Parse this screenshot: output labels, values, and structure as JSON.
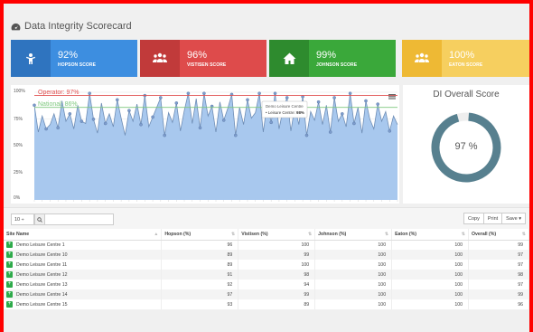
{
  "title": "Data Integrity Scorecard",
  "cards": [
    {
      "pct": "92%",
      "label": "HOPSON SCORE",
      "color": "#3d8ee0",
      "icon_bg": "#2f74bf",
      "icon": "person-icon"
    },
    {
      "pct": "96%",
      "label": "VISTISEN SCORE",
      "color": "#de4b4b",
      "icon_bg": "#c13a3a",
      "icon": "group-icon"
    },
    {
      "pct": "99%",
      "label": "JOHNSON SCORE",
      "color": "#3aa83a",
      "icon_bg": "#2e8b2e",
      "icon": "home-icon"
    },
    {
      "pct": "100%",
      "label": "EATON SCORE",
      "color": "#f6cf5f",
      "icon_bg": "#eeb934",
      "icon": "group-icon"
    }
  ],
  "chart": {
    "operator_label": "Operator: 97%",
    "national_label": "National: 86%",
    "operator_value": 97,
    "national_value": 86,
    "y_ticks": [
      "100%",
      "75%",
      "50%",
      "25%",
      "0%"
    ],
    "tooltip_title": "Demo Leisure Centre",
    "tooltip_line": "• Leisure Centre: ",
    "tooltip_value": "98%"
  },
  "chart_data": {
    "type": "area",
    "ylim": [
      0,
      100
    ],
    "grid": true,
    "series": [
      {
        "values": [
          88,
          63,
          78,
          66,
          70,
          80,
          67,
          92,
          73,
          80,
          66,
          88,
          73,
          71,
          99,
          75,
          62,
          90,
          71,
          80,
          68,
          93,
          76,
          60,
          83,
          73,
          89,
          70,
          97,
          68,
          77,
          86,
          95,
          60,
          81,
          72,
          90,
          64,
          83,
          99,
          71,
          94,
          67,
          99,
          78,
          87,
          63,
          91,
          74,
          85,
          98,
          60,
          86,
          70,
          93,
          76,
          81,
          99,
          63,
          90,
          72,
          99,
          66,
          84,
          95,
          64,
          87,
          70,
          96,
          60,
          82,
          74,
          91,
          70,
          88,
          63,
          95,
          73,
          80,
          68,
          99,
          71,
          86,
          62,
          92,
          75,
          66,
          89,
          73,
          82,
          64,
          78,
          70
        ]
      }
    ]
  },
  "overall": {
    "title": "DI Overall Score",
    "value": 97,
    "value_text": "97 %",
    "color": "#57808f"
  },
  "toolbar": {
    "page_size": "10 ÷",
    "copy": "Copy",
    "print": "Print",
    "save": "Save ▾"
  },
  "table": {
    "columns": [
      "Site Name",
      "Hopson (%)",
      "Vistisen (%)",
      "Johnson (%)",
      "Eaton (%)",
      "Overall (%)"
    ],
    "rows": [
      [
        "Demo Leisure Centre 1",
        "96",
        "100",
        "100",
        "100",
        "99"
      ],
      [
        "Demo Leisure Centre 10",
        "89",
        "99",
        "100",
        "100",
        "97"
      ],
      [
        "Demo Leisure Centre 11",
        "89",
        "100",
        "100",
        "100",
        "97"
      ],
      [
        "Demo Leisure Centre 12",
        "91",
        "98",
        "100",
        "100",
        "98"
      ],
      [
        "Demo Leisure Centre 13",
        "92",
        "94",
        "100",
        "100",
        "97"
      ],
      [
        "Demo Leisure Centre 14",
        "97",
        "99",
        "100",
        "100",
        "99"
      ],
      [
        "Demo Leisure Centre 15",
        "93",
        "89",
        "100",
        "100",
        "96"
      ]
    ]
  }
}
